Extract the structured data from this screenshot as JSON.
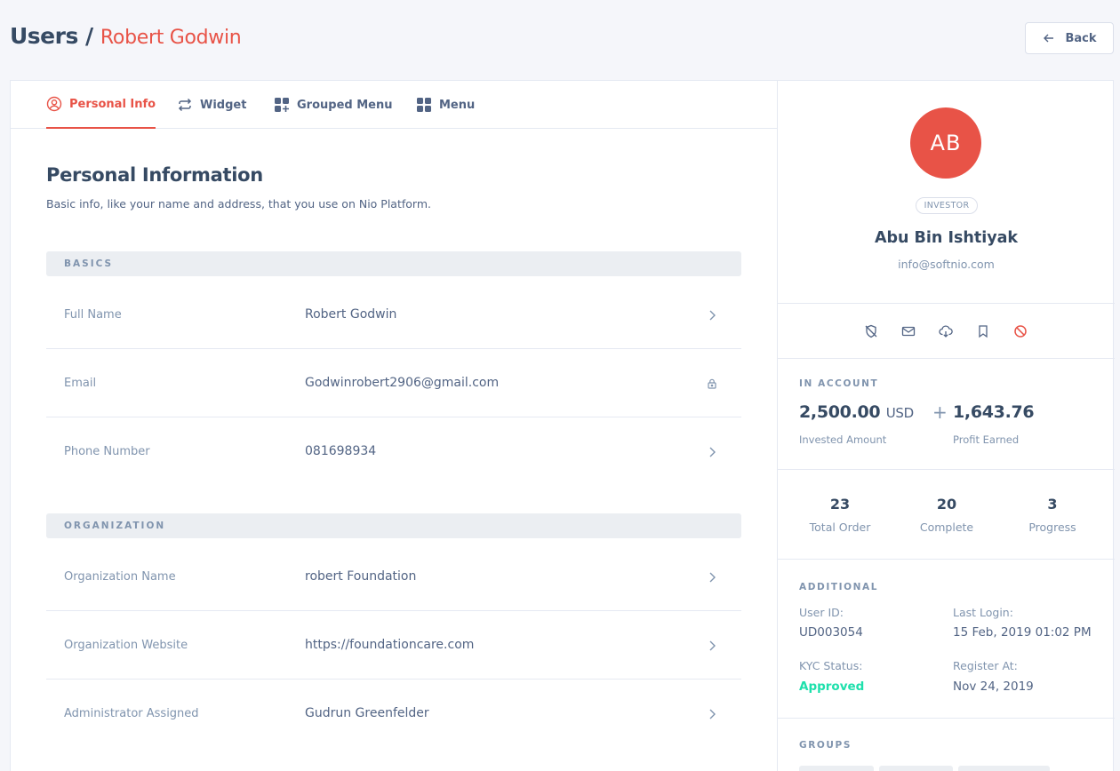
{
  "header": {
    "title": "Users /",
    "subtitle": "Robert Godwin",
    "back_label": "Back"
  },
  "tabs": [
    {
      "label": "Personal Info",
      "icon": "user-circle-icon",
      "active": true
    },
    {
      "label": "Widget",
      "icon": "repeat-icon",
      "active": false
    },
    {
      "label": "Grouped Menu",
      "icon": "grid-plus-icon",
      "active": false
    },
    {
      "label": "Menu",
      "icon": "grid-icon",
      "active": false
    }
  ],
  "content": {
    "title": "Personal Information",
    "description": "Basic info, like your name and address, that you use on Nio Platform."
  },
  "basics": {
    "heading": "BASICS",
    "rows": [
      {
        "label": "Full Name",
        "value": "Robert Godwin",
        "action": "chevron-right-icon"
      },
      {
        "label": "Email",
        "value": "Godwinrobert2906@gmail.com",
        "action": "lock-icon"
      },
      {
        "label": "Phone Number",
        "value": "081698934",
        "action": "chevron-right-icon"
      }
    ]
  },
  "organization": {
    "heading": "ORGANIZATION",
    "rows": [
      {
        "label": "Organization Name",
        "value": "robert Foundation",
        "action": "chevron-right-icon"
      },
      {
        "label": "Organization Website",
        "value": "https://foundationcare.com",
        "action": "chevron-right-icon"
      },
      {
        "label": "Administrator Assigned",
        "value": "Gudrun Greenfelder",
        "action": "chevron-right-icon"
      }
    ]
  },
  "profile": {
    "initials": "AB",
    "badge": "INVESTOR",
    "name": "Abu Bin Ishtiyak",
    "email": "info@softnio.com",
    "avatar_color": "#e85347",
    "actions": [
      "shield-off-icon",
      "mail-icon",
      "download-cloud-icon",
      "bookmark-icon",
      "block-icon"
    ]
  },
  "account": {
    "heading": "IN ACCOUNT",
    "invested_value": "2,500.00",
    "invested_currency": "USD",
    "invested_label": "Invested Amount",
    "profit_value": "1,643.76",
    "profit_label": "Profit Earned"
  },
  "stats": [
    {
      "value": "23",
      "label": "Total Order"
    },
    {
      "value": "20",
      "label": "Complete"
    },
    {
      "value": "3",
      "label": "Progress"
    }
  ],
  "additional": {
    "heading": "ADDITIONAL",
    "user_id_label": "User ID:",
    "user_id": "UD003054",
    "last_login_label": "Last Login:",
    "last_login": "15 Feb, 2019 01:02 PM",
    "kyc_label": "KYC Status:",
    "kyc_value": "Approved",
    "register_label": "Register At:",
    "register_value": "Nov 24, 2019"
  },
  "groups": {
    "heading": "GROUPS"
  },
  "colors": {
    "accent": "#e85347",
    "success": "#1ee0ac",
    "text": "#364a63",
    "muted": "#8094ae"
  }
}
